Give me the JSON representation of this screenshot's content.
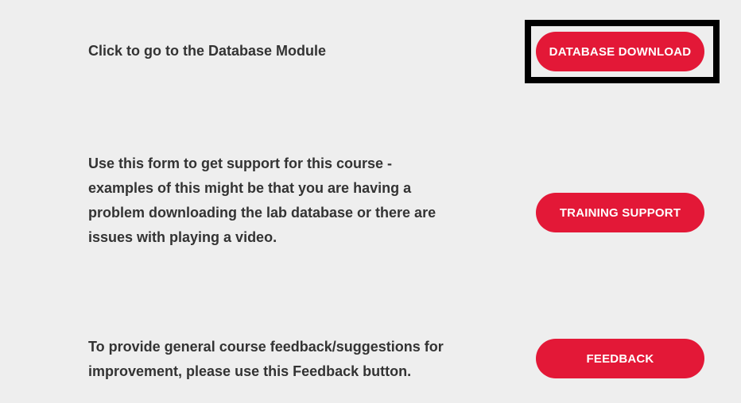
{
  "rows": [
    {
      "description": "Click to go to the Database Module",
      "button_label": "DATABASE DOWNLOAD",
      "focused": true
    },
    {
      "description": "Use this form to get support for this course - examples of this might be that you are having a problem downloading the lab database or there are issues with playing a video.",
      "button_label": "TRAINING SUPPORT",
      "focused": false
    },
    {
      "description": "To provide general course feedback/suggestions for improvement, please use this Feedback button.",
      "button_label": "FEEDBACK",
      "focused": false
    }
  ],
  "colors": {
    "background": "#eeeeee",
    "text": "#333333",
    "button": "#e31837",
    "button_text": "#ffffff",
    "focus_frame": "#000000"
  }
}
